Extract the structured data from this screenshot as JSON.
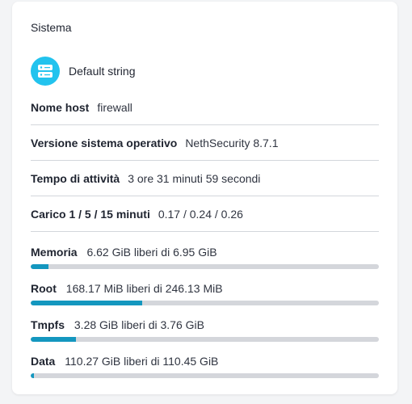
{
  "card": {
    "title": "Sistema",
    "device": {
      "icon": "server-icon",
      "label": "Default string"
    },
    "info": [
      {
        "label": "Nome host",
        "value": "firewall"
      },
      {
        "label": "Versione sistema operativo",
        "value": "NethSecurity 8.7.1"
      },
      {
        "label": "Tempo di attività",
        "value": "3 ore 31 minuti 59 secondi"
      },
      {
        "label": "Carico 1 / 5 / 15 minuti",
        "value": "0.17 / 0.24 / 0.26"
      }
    ],
    "usage": [
      {
        "label": "Memoria",
        "value": "6.62 GiB liberi di 6.95 GiB",
        "used_fraction": 0.05
      },
      {
        "label": "Root",
        "value": "168.17 MiB liberi di 246.13 MiB",
        "used_fraction": 0.32
      },
      {
        "label": "Tmpfs",
        "value": "3.28 GiB liberi di 3.76 GiB",
        "used_fraction": 0.13
      },
      {
        "label": "Data",
        "value": "110.27 GiB liberi di 110.45 GiB",
        "used_fraction": 0.01
      }
    ]
  },
  "colors": {
    "accent": "#1497bf",
    "icon_bg": "#22c3ee",
    "track": "#d4d6db"
  }
}
